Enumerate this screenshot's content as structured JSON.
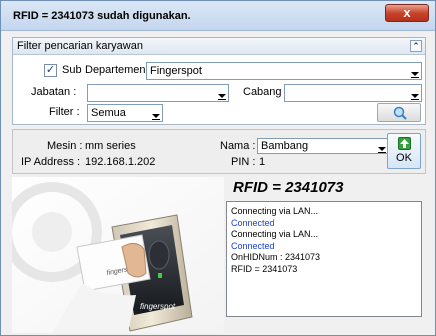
{
  "window": {
    "title": "RFID = 2341073 sudah digunakan.",
    "close_label": "x"
  },
  "filter": {
    "header": "Filter pencarian karyawan",
    "sub_label": "Sub",
    "sub_checked": true,
    "departemen_label": "Departemen :",
    "departemen_value": "Fingerspot",
    "jabatan_label": "Jabatan :",
    "jabatan_value": "",
    "cabang_label": "Cabang :",
    "cabang_value": "",
    "filter_label": "Filter :",
    "filter_value": "Semua",
    "search_icon": "magnifier-icon"
  },
  "machine": {
    "mesin_label": "Mesin :",
    "mesin_value": "mm series",
    "ip_label": "IP Address :",
    "ip_value": "192.168.1.202",
    "nama_label": "Nama :",
    "nama_value": "Bambang",
    "pin_label": "PIN :",
    "pin_value": "1",
    "ok_label": "OK"
  },
  "rfid_display": "RFID = 2341073",
  "log": [
    {
      "text": "Connecting via LAN...",
      "color": "#000000"
    },
    {
      "text": "Connected",
      "color": "#1a3fd6"
    },
    {
      "text": "Connecting via LAN...",
      "color": "#000000"
    },
    {
      "text": "Connected",
      "color": "#1a3fd6"
    },
    {
      "text": "OnHIDNum : 2341073",
      "color": "#000000"
    },
    {
      "text": "RFID = 2341073",
      "color": "#000000"
    }
  ],
  "device_image": {
    "device_brand": "fingerspot",
    "card_brand": "fingerspot"
  }
}
